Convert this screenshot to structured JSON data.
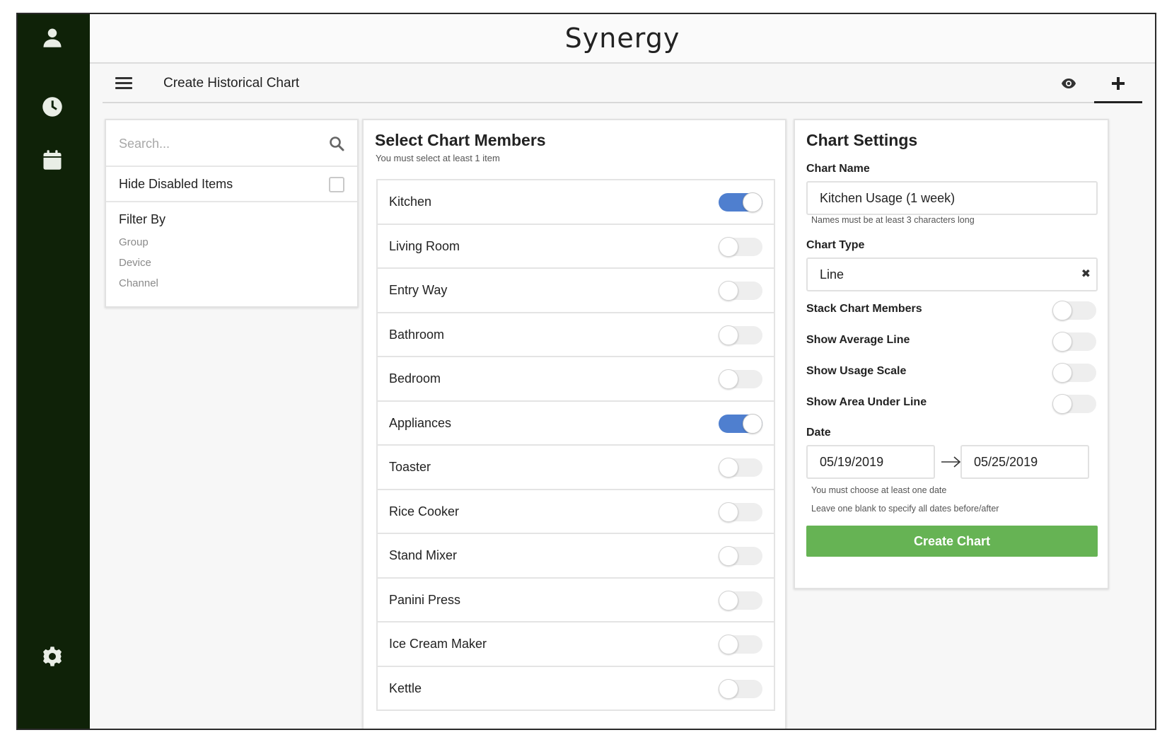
{
  "app": {
    "title": "Synergy"
  },
  "sidebar": {
    "items": [
      {
        "icon": "user-icon"
      },
      {
        "icon": "clock-icon"
      },
      {
        "icon": "calendar-icon"
      },
      {
        "icon": "gear-icon"
      }
    ]
  },
  "toolbar": {
    "title": "Create Historical Chart"
  },
  "filter": {
    "search_placeholder": "Search...",
    "hide_disabled_label": "Hide Disabled Items",
    "hide_disabled_checked": false,
    "filter_by_label": "Filter By",
    "options": [
      "Group",
      "Device",
      "Channel"
    ]
  },
  "members": {
    "title": "Select Chart Members",
    "subtitle": "You must select at least 1 item",
    "items": [
      {
        "label": "Kitchen",
        "on": true
      },
      {
        "label": "Living Room",
        "on": false
      },
      {
        "label": "Entry Way",
        "on": false
      },
      {
        "label": "Bathroom",
        "on": false
      },
      {
        "label": "Bedroom",
        "on": false
      },
      {
        "label": "Appliances",
        "on": true
      },
      {
        "label": "Toaster",
        "on": false
      },
      {
        "label": "Rice Cooker",
        "on": false
      },
      {
        "label": "Stand Mixer",
        "on": false
      },
      {
        "label": "Panini Press",
        "on": false
      },
      {
        "label": "Ice Cream Maker",
        "on": false
      },
      {
        "label": "Kettle",
        "on": false
      }
    ]
  },
  "settings": {
    "title": "Chart Settings",
    "chart_name_label": "Chart Name",
    "chart_name_value": "Kitchen Usage (1 week)",
    "chart_name_hint": "Names must be at least 3 characters long",
    "chart_type_label": "Chart Type",
    "chart_type_value": "Line",
    "chart_type_clear": "✖",
    "options": [
      {
        "label": "Stack Chart Members",
        "on": false
      },
      {
        "label": "Show Average Line",
        "on": false
      },
      {
        "label": "Show Usage Scale",
        "on": false
      },
      {
        "label": "Show Area Under Line",
        "on": false
      }
    ],
    "date_label": "Date",
    "date_start": "05/19/2019",
    "date_end": "05/25/2019",
    "date_hint_1": "You must choose at least one date",
    "date_hint_2": "Leave one blank to specify all dates before/after",
    "create_button": "Create Chart"
  },
  "colors": {
    "sidebar_bg": "#0f2208",
    "toggle_on": "#4f7fcf",
    "create_button": "#66b354"
  }
}
